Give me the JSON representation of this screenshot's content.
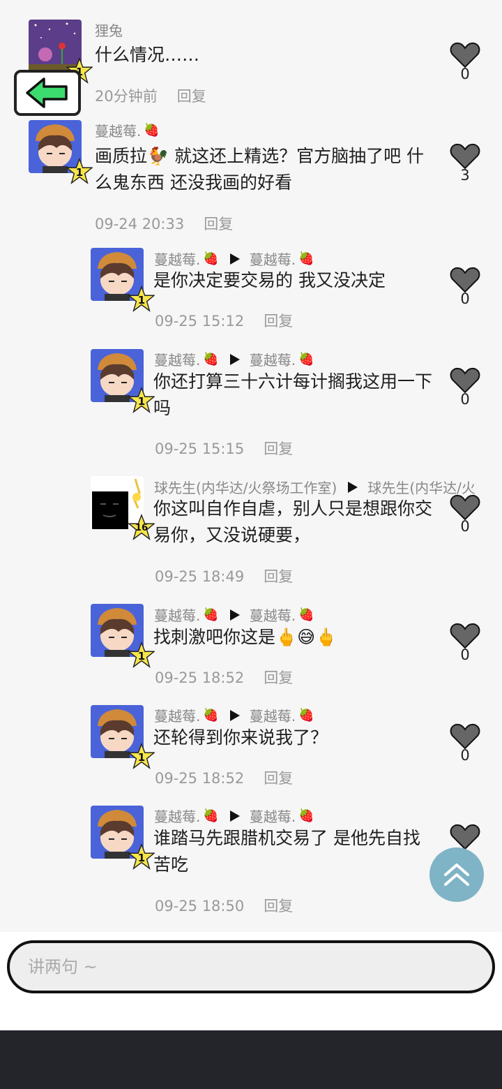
{
  "comments": [
    {
      "author": "狸兔",
      "level": "1",
      "text": "什么情况……",
      "time": "20分钟前",
      "reply": "回复",
      "likes": "0"
    },
    {
      "author": "蔓越莓.",
      "level": "1",
      "text": "画质拉🐓 就这还上精选？官方脑抽了吧 什么鬼东西 还没我画的好看",
      "time": "09-24 20:33",
      "reply": "回复",
      "likes": "3"
    },
    {
      "author": "蔓越莓.",
      "target": "蔓越莓.",
      "level": "1",
      "text": "是你决定要交易的 我又没决定",
      "time": "09-25 15:12",
      "reply": "回复",
      "likes": "0"
    },
    {
      "author": "蔓越莓.",
      "target": "蔓越莓.",
      "level": "1",
      "text": "你还打算三十六计每计搁我这用一下吗",
      "time": "09-25 15:15",
      "reply": "回复",
      "likes": "0"
    },
    {
      "author": "球先生(内华达/火祭场工作室)",
      "target": "球先生(内华达/火",
      "level": "16",
      "text": "你这叫自作自虐，别人只是想跟你交易你，又没说硬要，",
      "time": "09-25 18:49",
      "reply": "回复",
      "likes": "0"
    },
    {
      "author": "蔓越莓.",
      "target": "蔓越莓.",
      "level": "1",
      "text": "找刺激吧你这是🖕😅🖕",
      "time": "09-25 18:52",
      "reply": "回复",
      "likes": "0"
    },
    {
      "author": "蔓越莓.",
      "target": "蔓越莓.",
      "level": "1",
      "text": "还轮得到你来说我了？",
      "time": "09-25 18:52",
      "reply": "回复",
      "likes": "0"
    },
    {
      "author": "蔓越莓.",
      "target": "蔓越莓.",
      "level": "1",
      "text": "谁踏马先跟腊机交易了 是他先自找苦吃",
      "time": "09-25 18:50",
      "reply": "回复",
      "likes": ""
    }
  ],
  "input": {
    "placeholder": "讲两句 ~"
  },
  "icons": {
    "back": "left-arrow-icon",
    "like": "heart-icon",
    "scroll_top": "double-chevron-up-icon",
    "level": "star-badge-icon",
    "strawberry": "🍓"
  },
  "colors": {
    "accent_green": "#3ddc6e",
    "scroll_top_bg": "#7fb3c6",
    "bottom_bar": "#23252b"
  }
}
